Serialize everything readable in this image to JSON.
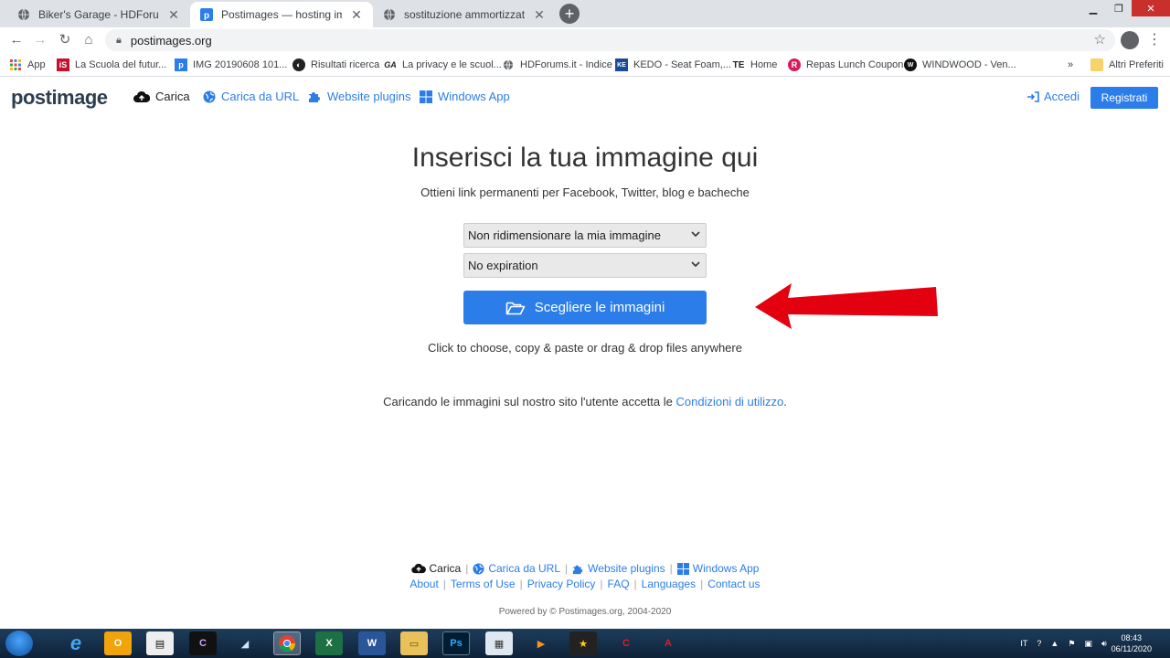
{
  "browser": {
    "tabs": [
      {
        "title": "Biker's Garage - HDForums.it",
        "active": false
      },
      {
        "title": "Postimages — hosting immagini",
        "active": true
      },
      {
        "title": "sostituzione ammortizzatori post",
        "active": false
      }
    ],
    "new_tab_label": "+",
    "url": "postimages.org",
    "bookmarks": [
      "App",
      "La Scuola del futur...",
      "IMG 20190608 101...",
      "Risultati ricerca",
      "La privacy e le scuol...",
      "HDForums.it - Indice",
      "KEDO - Seat Foam,...",
      "Home",
      "Repas Lunch Coupon",
      "WINDWOOD - Ven..."
    ],
    "bookmarks_overflow": "»",
    "other_bookmarks": "Altri Preferiti"
  },
  "site": {
    "logo": "postimage",
    "nav": {
      "upload": "Carica",
      "upload_url": "Carica da URL",
      "plugins": "Website plugins",
      "windows_app": "Windows App",
      "login": "Accedi",
      "register": "Registrati"
    },
    "hero": {
      "title": "Inserisci la tua immagine qui",
      "subtitle": "Ottieni link permanenti per Facebook, Twitter, blog e bacheche",
      "resize_select": "Non ridimensionare la mia immagine",
      "expiration_select": "No expiration",
      "choose_button": "Scegliere le immagini",
      "hint": "Click to choose, copy & paste or drag & drop files anywhere",
      "terms_text": "Caricando le immagini sul nostro sito l'utente accetta le ",
      "terms_link": "Condizioni di utilizzo",
      "terms_end": "."
    },
    "footer": {
      "row1": [
        "Carica",
        "Carica da URL",
        "Website plugins",
        "Windows App"
      ],
      "row2": [
        "About",
        "Terms of Use",
        "Privacy Policy",
        "FAQ",
        "Languages",
        "Contact us"
      ],
      "powered": "Powered by © Postimages.org, 2004-2020"
    }
  },
  "taskbar": {
    "language": "IT",
    "time": "08:43",
    "date": "06/11/2020"
  },
  "colors": {
    "accent": "#2b7de9",
    "arrow": "#e3000f"
  }
}
